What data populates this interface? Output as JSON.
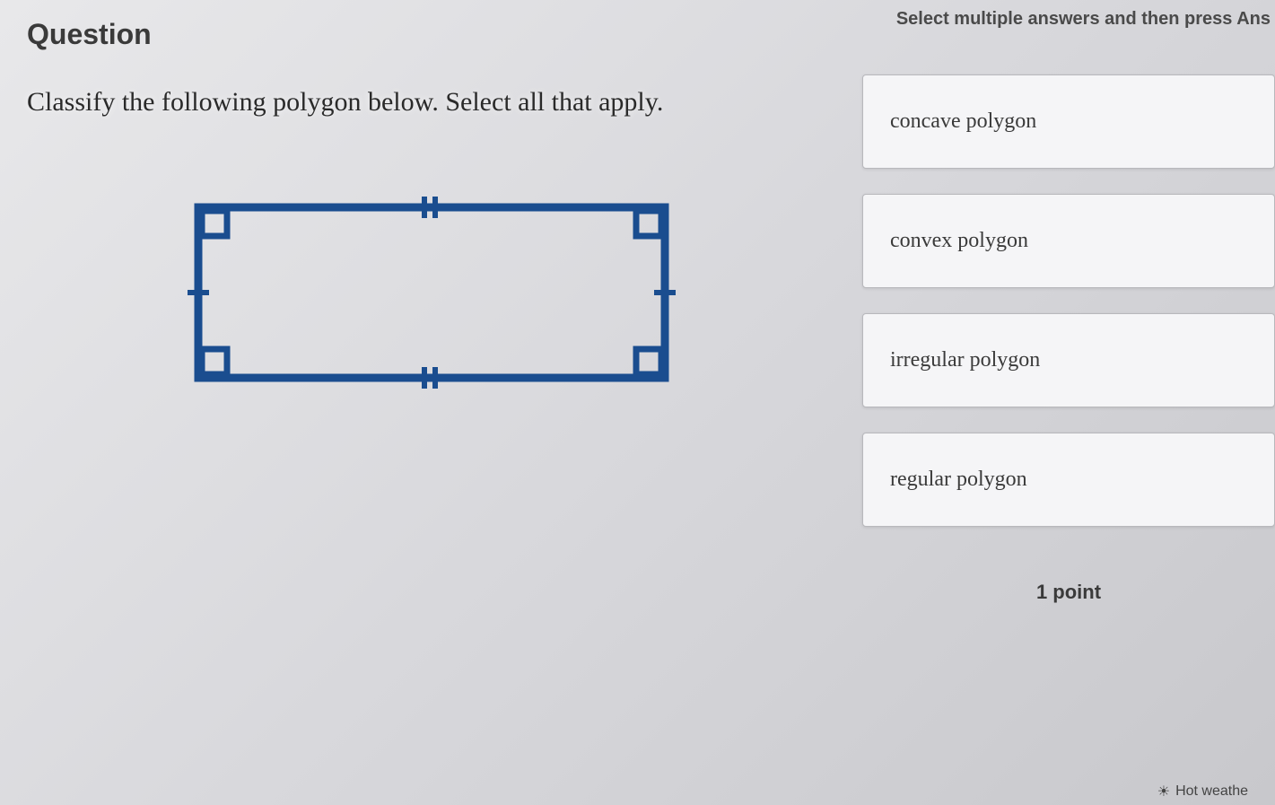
{
  "header": {
    "question_label": "Question",
    "instruction": "Select multiple answers and then press Ans"
  },
  "question": {
    "text": "Classify the following polygon below. Select all that apply."
  },
  "answers": {
    "options": [
      "concave polygon",
      "convex polygon",
      "irregular polygon",
      "regular polygon"
    ]
  },
  "footer": {
    "points": "1 point"
  },
  "taskbar": {
    "weather": "Hot weathe"
  },
  "figure": {
    "type": "rectangle",
    "stroke_color": "#1a4d8f",
    "has_right_angles": true,
    "top_bottom_congruent": true,
    "left_right_congruent": true
  }
}
